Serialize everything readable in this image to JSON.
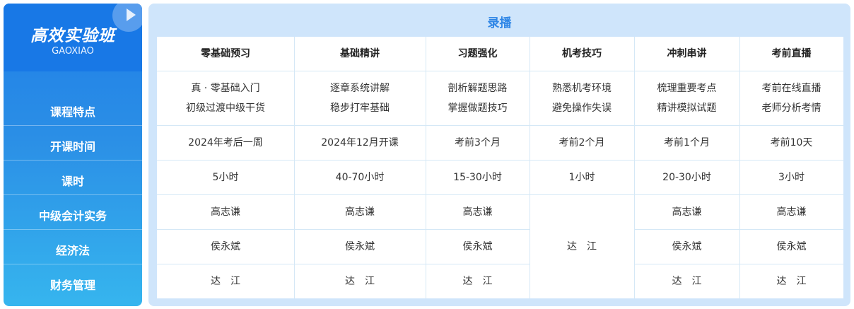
{
  "left": {
    "title": "高效实验班",
    "subtitle": "GAOXIAO",
    "rows": [
      "课程特点",
      "开课时间",
      "课时",
      "中级会计实务",
      "经济法",
      "财务管理"
    ]
  },
  "section_title": "录播",
  "columns": [
    {
      "header": "零基础预习",
      "feature": [
        "真 · 零基础入门",
        "初级过渡中级干货"
      ],
      "start": "2024年考后一周",
      "hours": "5小时",
      "accounting": "高志谦",
      "law": "侯永斌",
      "finance": "达　江"
    },
    {
      "header": "基础精讲",
      "feature": [
        "逐章系统讲解",
        "稳步打牢基础"
      ],
      "start": "2024年12月开课",
      "hours": "40-70小时",
      "accounting": "高志谦",
      "law": "侯永斌",
      "finance": "达　江"
    },
    {
      "header": "习题强化",
      "feature": [
        "剖析解题思路",
        "掌握做题技巧"
      ],
      "start": "考前3个月",
      "hours": "15-30小时",
      "accounting": "高志谦",
      "law": "侯永斌",
      "finance": "达　江"
    },
    {
      "header": "机考技巧",
      "feature": [
        "熟悉机考环境",
        "避免操作失误"
      ],
      "start": "考前2个月",
      "hours": "1小时",
      "merged": "达　江"
    },
    {
      "header": "冲刺串讲",
      "feature": [
        "梳理重要考点",
        "精讲模拟试题"
      ],
      "start": "考前1个月",
      "hours": "20-30小时",
      "accounting": "高志谦",
      "law": "侯永斌",
      "finance": "达　江"
    },
    {
      "header": "考前直播",
      "feature": [
        "考前在线直播",
        "老师分析考情"
      ],
      "start": "考前10天",
      "hours": "3小时",
      "accounting": "高志谦",
      "law": "侯永斌",
      "finance": "达　江"
    }
  ]
}
